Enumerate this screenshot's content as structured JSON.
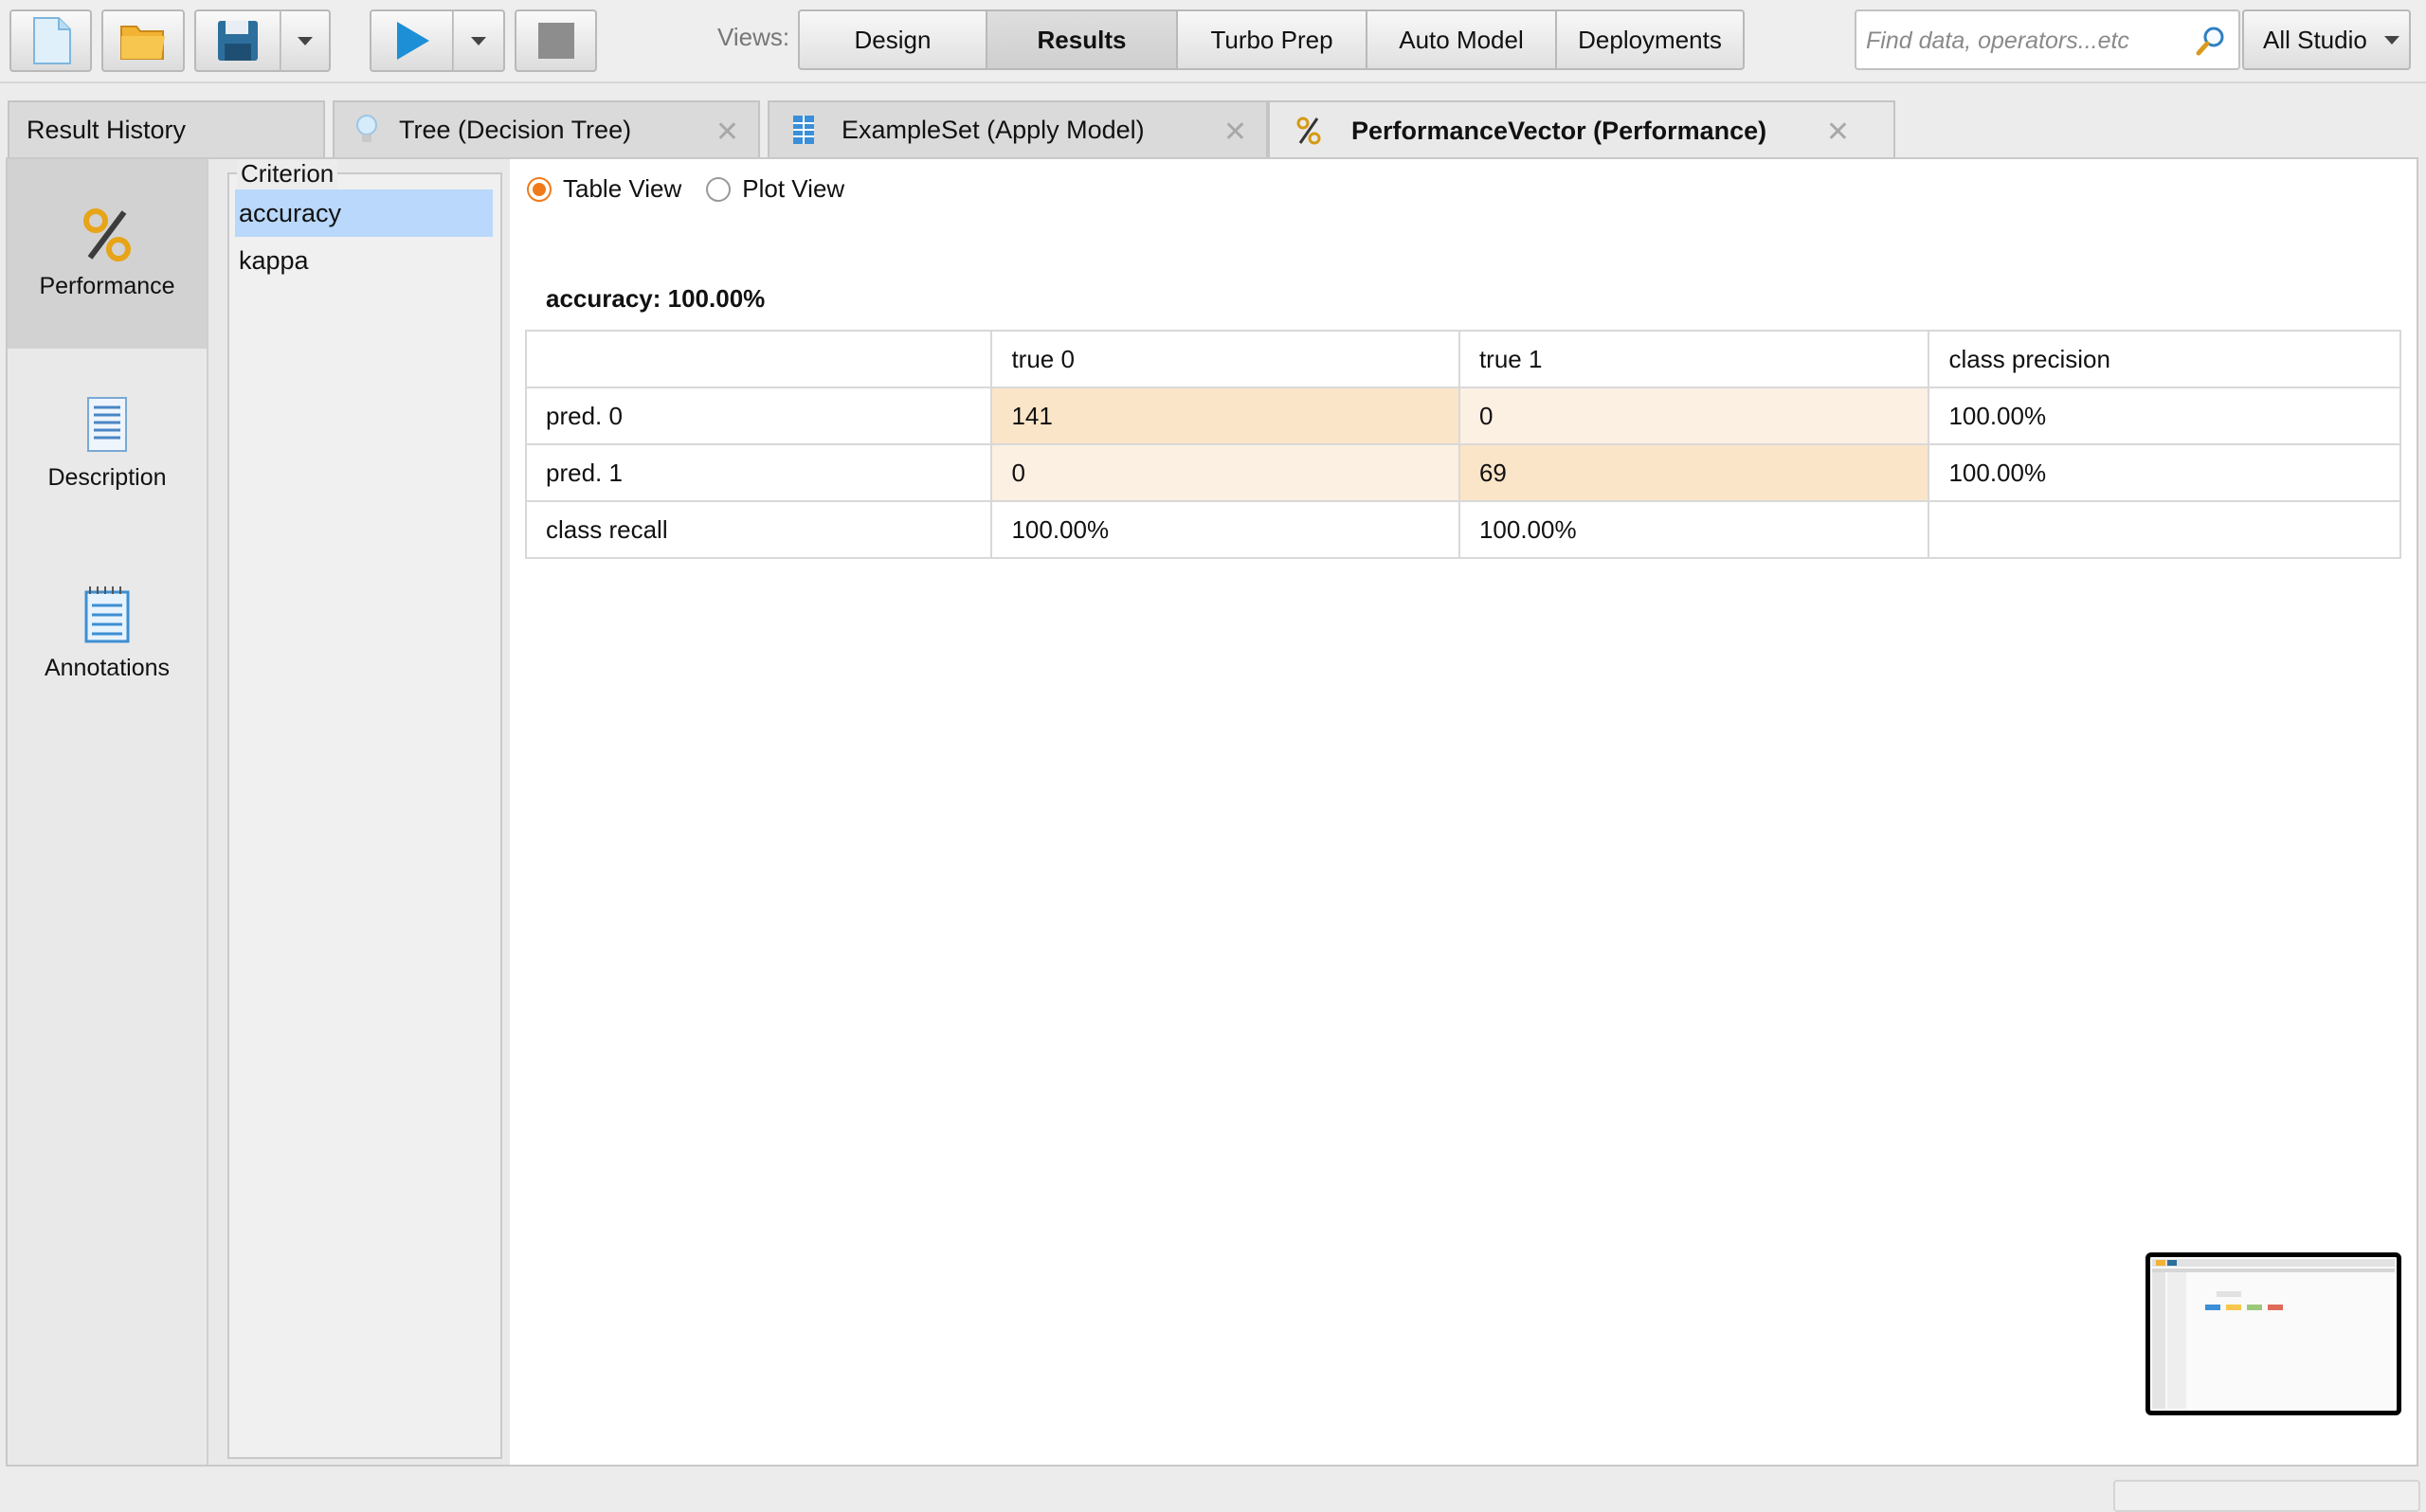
{
  "toolbar": {
    "views_label": "Views:",
    "view_tabs": [
      "Design",
      "Results",
      "Turbo Prep",
      "Auto Model",
      "Deployments"
    ],
    "active_view": "Results",
    "search_placeholder": "Find data, operators...etc",
    "studio_label": "All Studio"
  },
  "editor_tabs": [
    {
      "label": "Result History",
      "closable": false
    },
    {
      "label": "Tree (Decision Tree)",
      "icon": "lightbulb-icon",
      "closable": true
    },
    {
      "label": "ExampleSet (Apply Model)",
      "icon": "table-icon",
      "closable": true
    },
    {
      "label": "PerformanceVector (Performance)",
      "icon": "percent-icon",
      "closable": true,
      "active": true
    }
  ],
  "sidebar": {
    "items": [
      {
        "label": "Performance",
        "icon": "percent-icon",
        "active": true
      },
      {
        "label": "Description",
        "icon": "document-icon"
      },
      {
        "label": "Annotations",
        "icon": "notepad-icon"
      }
    ]
  },
  "criterion": {
    "legend": "Criterion",
    "items": [
      "accuracy",
      "kappa"
    ],
    "selected": "accuracy"
  },
  "view_mode": {
    "options": [
      "Table View",
      "Plot View"
    ],
    "selected": "Table View"
  },
  "result": {
    "title": "accuracy: 100.00%",
    "header": [
      "",
      "true 0",
      "true 1",
      "class precision"
    ],
    "rows": [
      [
        "pred. 0",
        "141",
        "0",
        "100.00%"
      ],
      [
        "pred. 1",
        "0",
        "69",
        "100.00%"
      ],
      [
        "class recall",
        "100.00%",
        "100.00%",
        ""
      ]
    ]
  },
  "colors": {
    "accent": "#f07a1a",
    "selection": "#b9d8fb",
    "cell_highlight": "#fbe5c8",
    "cell_light": "#fcf0e3"
  }
}
